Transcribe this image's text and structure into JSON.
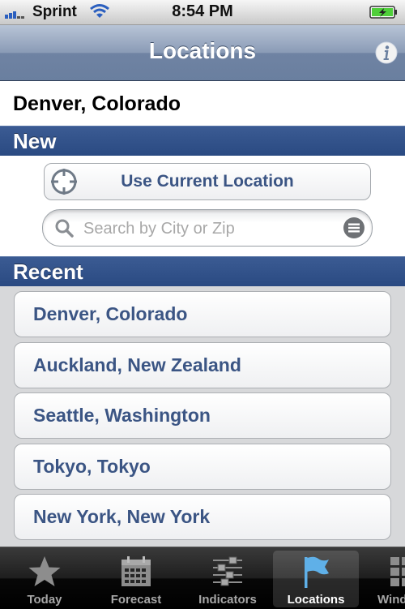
{
  "status_bar": {
    "carrier": "Sprint",
    "time": "8:54 PM",
    "icons": [
      "signal-icon",
      "wifi-icon",
      "battery-charging-icon"
    ]
  },
  "nav": {
    "title": "Locations",
    "info_icon": "info-icon"
  },
  "current_location": "Denver, Colorado",
  "sections": {
    "new": "New",
    "recent": "Recent"
  },
  "use_current_location": {
    "label": "Use Current Location",
    "icon": "crosshair-icon"
  },
  "search": {
    "placeholder": "Search by City or Zip",
    "value": "",
    "icon": "search-icon",
    "list_icon": "list-icon"
  },
  "recent": [
    "Denver, Colorado",
    "Auckland, New Zealand",
    "Seattle, Washington",
    "Tokyo, Tokyo",
    "New York, New York"
  ],
  "tabs": [
    {
      "label": "Today",
      "icon": "star-icon",
      "active": false
    },
    {
      "label": "Forecast",
      "icon": "calendar-icon",
      "active": false
    },
    {
      "label": "Indicators",
      "icon": "sliders-icon",
      "active": false
    },
    {
      "label": "Locations",
      "icon": "flag-icon",
      "active": true
    },
    {
      "label": "Wind",
      "icon": "grid-icon",
      "active": false
    }
  ],
  "colors": {
    "section_header": "#2f4f87",
    "link_text": "#3b5584",
    "active_tab": "#5fb0e8"
  }
}
